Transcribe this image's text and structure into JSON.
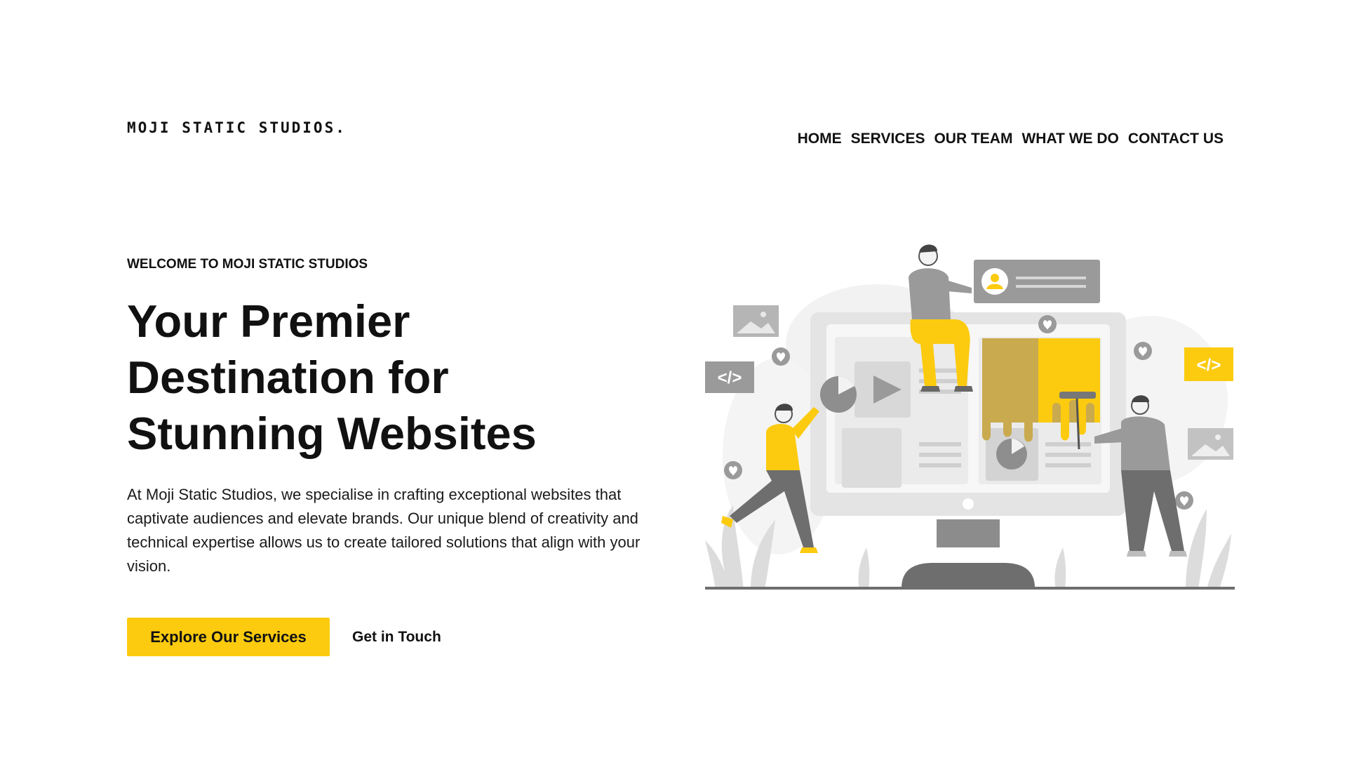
{
  "header": {
    "logo": "MOJI STATIC STUDIOS.",
    "nav": [
      {
        "label": "HOME"
      },
      {
        "label": "SERVICES"
      },
      {
        "label": "OUR TEAM"
      },
      {
        "label": "WHAT WE DO"
      },
      {
        "label": "CONTACT US"
      }
    ]
  },
  "hero": {
    "eyebrow": "WELCOME TO MOJI STATIC STUDIOS",
    "headline": "Your Premier Destination for Stunning Websites",
    "lead": "At Moji Static Studios, we specialise in crafting exceptional websites that captivate audiences and elevate brands. Our unique blend of creativity and technical expertise allows us to create tailored solutions that align with your vision.",
    "primary_cta": "Explore Our Services",
    "secondary_cta": "Get in Touch"
  },
  "illustration": {
    "code_tag": "</>"
  },
  "colors": {
    "accent": "#fccb0f",
    "text": "#111111",
    "illustration_gray": "#8e8e8e",
    "illustration_light": "#ececec"
  }
}
